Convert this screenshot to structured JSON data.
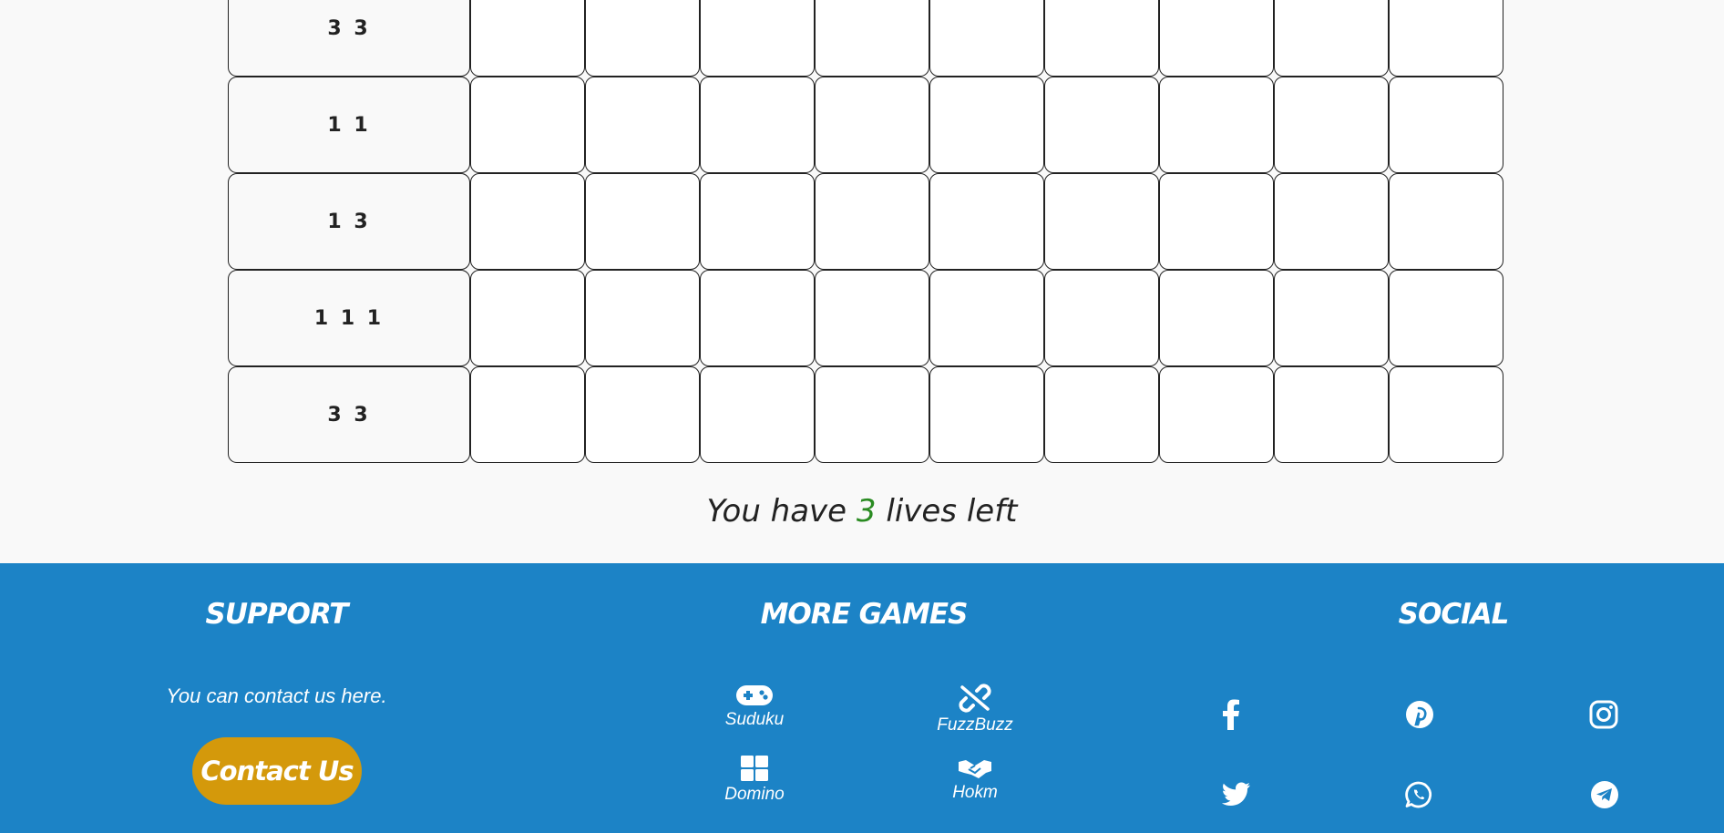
{
  "board": {
    "clues": [
      "3 3",
      "1 1",
      "1 3",
      "1 1 1",
      "3 3"
    ],
    "columns": 9
  },
  "lives": {
    "prefix": "You have",
    "count": "3",
    "suffix": "lives left"
  },
  "footer": {
    "support": {
      "heading": "SUPPORT",
      "text": "You can contact us here.",
      "button": "Contact Us"
    },
    "more_games": {
      "heading": "MORE GAMES",
      "items": [
        {
          "label": "Suduku",
          "icon": "gamepad-icon"
        },
        {
          "label": "FuzzBuzz",
          "icon": "broken-link-icon"
        },
        {
          "label": "Domino",
          "icon": "grid-icon"
        },
        {
          "label": "Hokm",
          "icon": "handshake-icon"
        }
      ]
    },
    "social": {
      "heading": "SOCIAL",
      "items": [
        "facebook-icon",
        "pinterest-icon",
        "instagram-icon",
        "twitter-icon",
        "whatsapp-icon",
        "telegram-icon"
      ]
    }
  },
  "colors": {
    "footer_bg": "#1c83c6",
    "button_bg": "#d4990b",
    "lives_count": "#2a8b22",
    "page_bg": "#f9f9f9"
  }
}
